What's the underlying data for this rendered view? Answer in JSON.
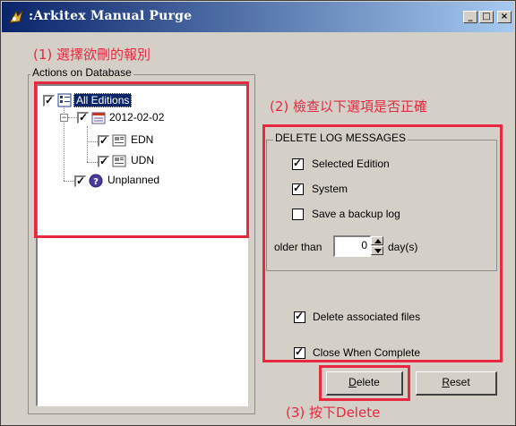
{
  "window": {
    "title": ":Arkitex Manual Purge",
    "controls": {
      "minimize": "_",
      "maximize": "□",
      "close": "×"
    }
  },
  "annotations": {
    "step1": "(1) 選擇欲刪的報別",
    "step2": "(2) 檢查以下選項是否正確",
    "step3": "(3) 按下Delete"
  },
  "actions_group": {
    "legend": "Actions on Database",
    "tree": [
      {
        "label": "All Editions",
        "checked": true,
        "selected": true,
        "icon": "editions-icon"
      },
      {
        "label": "2012-02-02",
        "checked": true,
        "expander": "−",
        "icon": "calendar-icon"
      },
      {
        "label": "EDN",
        "checked": true,
        "icon": "newspaper-icon"
      },
      {
        "label": "UDN",
        "checked": true,
        "icon": "newspaper-icon"
      },
      {
        "label": "Unplanned",
        "checked": true,
        "icon": "question-icon"
      }
    ]
  },
  "log_group": {
    "legend": "DELETE LOG MESSAGES",
    "options": [
      {
        "label": "Selected Edition",
        "checked": true
      },
      {
        "label": "System",
        "checked": true
      },
      {
        "label": "Save a backup log",
        "checked": false
      }
    ],
    "older_than_label": "older than",
    "days_value": "0",
    "days_unit": "day(s)"
  },
  "extra_options": [
    {
      "label": "Delete associated files",
      "checked": true
    },
    {
      "label": "Close When Complete",
      "checked": true
    }
  ],
  "buttons": {
    "delete": {
      "accel": "D",
      "rest": "elete"
    },
    "reset": {
      "accel": "R",
      "rest": "eset"
    }
  },
  "colors": {
    "annotation": "#e8283e",
    "titlebar_start": "#0a246a",
    "titlebar_end": "#a6caf0",
    "face": "#d4d0c8"
  }
}
